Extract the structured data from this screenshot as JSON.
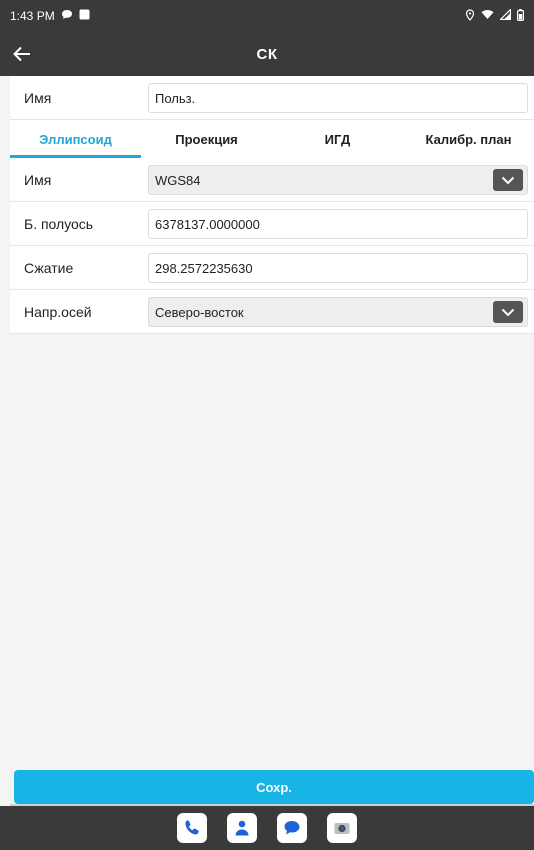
{
  "status_bar": {
    "time": "1:43 PM"
  },
  "app_bar": {
    "title": "СК"
  },
  "name_row": {
    "label": "Имя",
    "value": "Польз."
  },
  "tabs": [
    {
      "label": "Эллипсоид",
      "active": true
    },
    {
      "label": "Проекция",
      "active": false
    },
    {
      "label": "ИГД",
      "active": false
    },
    {
      "label": "Калибр. план",
      "active": false
    }
  ],
  "ellipsoid": {
    "name": {
      "label": "Имя",
      "value": "WGS84"
    },
    "semi_axis": {
      "label": "Б. полуось",
      "value": "6378137.0000000"
    },
    "flattening": {
      "label": "Сжатие",
      "value": "298.2572235630"
    },
    "axis_direction": {
      "label": "Напр.осей",
      "value": "Северо-восток"
    }
  },
  "save_button": {
    "label": "Сохр."
  },
  "colors": {
    "accent": "#17b4e6",
    "bar": "#3a3a3a"
  },
  "icons": {
    "status": [
      "chat-bubble-icon",
      "notification-square-icon",
      "location-icon",
      "wifi-icon",
      "signal-icon",
      "battery-icon"
    ],
    "dock": [
      "phone-app-icon",
      "contacts-app-icon",
      "messages-app-icon",
      "camera-app-icon"
    ]
  }
}
